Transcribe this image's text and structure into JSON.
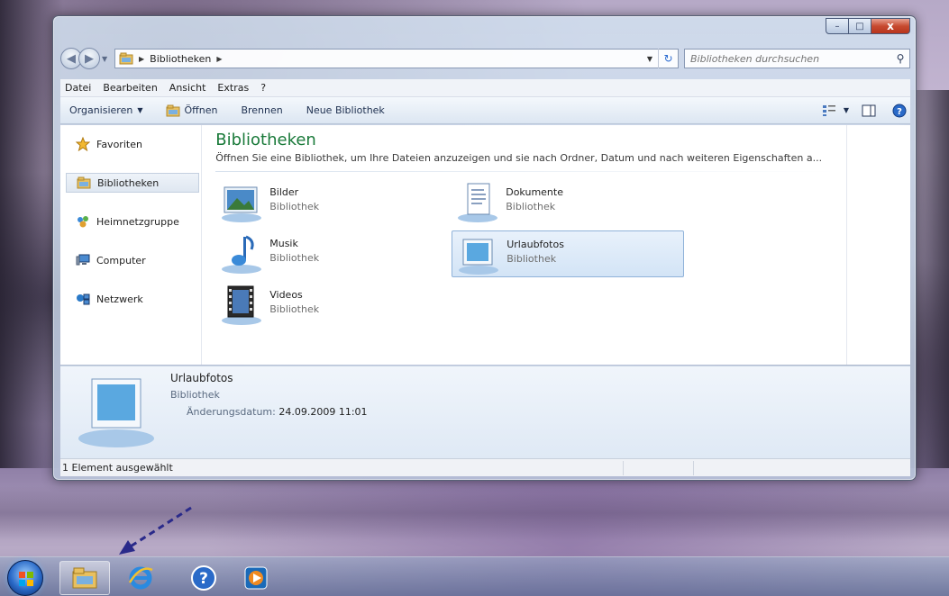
{
  "window": {
    "controls": {
      "minimize": "–",
      "maximize": "□",
      "close": "x"
    }
  },
  "address": {
    "crumb": "Bibliotheken",
    "back": "◀",
    "forward": "▶"
  },
  "search": {
    "placeholder": "Bibliotheken durchsuchen"
  },
  "menu": [
    "Datei",
    "Bearbeiten",
    "Ansicht",
    "Extras",
    "?"
  ],
  "commands": {
    "organize": "Organisieren",
    "open": "Öffnen",
    "burn": "Brennen",
    "new_library": "Neue Bibliothek"
  },
  "nav": [
    {
      "label": "Favoriten",
      "icon": "star-icon"
    },
    {
      "label": "Bibliotheken",
      "icon": "libraries-icon"
    },
    {
      "label": "Heimnetzgruppe",
      "icon": "homegroup-icon"
    },
    {
      "label": "Computer",
      "icon": "computer-icon"
    },
    {
      "label": "Netzwerk",
      "icon": "network-icon"
    }
  ],
  "main": {
    "title": "Bibliotheken",
    "description": "Öffnen Sie eine Bibliothek, um Ihre Dateien anzuzeigen und sie nach Ordner, Datum und nach weiteren Eigenschaften a...",
    "libraries": [
      {
        "name": "Bilder",
        "type": "Bibliothek",
        "icon": "pictures-library-icon"
      },
      {
        "name": "Dokumente",
        "type": "Bibliothek",
        "icon": "documents-library-icon"
      },
      {
        "name": "Musik",
        "type": "Bibliothek",
        "icon": "music-library-icon"
      },
      {
        "name": "Urlaubfotos",
        "type": "Bibliothek",
        "icon": "generic-library-icon",
        "selected": true
      },
      {
        "name": "Videos",
        "type": "Bibliothek",
        "icon": "videos-library-icon"
      }
    ]
  },
  "details": {
    "name": "Urlaubfotos",
    "type": "Bibliothek",
    "date_key": "Änderungsdatum:",
    "date_value": "24.09.2009 11:01"
  },
  "status": {
    "text": "1 Element ausgewählt"
  },
  "taskbar": {
    "items": [
      "start-orb",
      "explorer",
      "internet-explorer",
      "help",
      "media-player"
    ]
  },
  "colors": {
    "title_green": "#1a7a3a",
    "selection_blue": "#d3e4f6",
    "close_red": "#c74a30"
  }
}
